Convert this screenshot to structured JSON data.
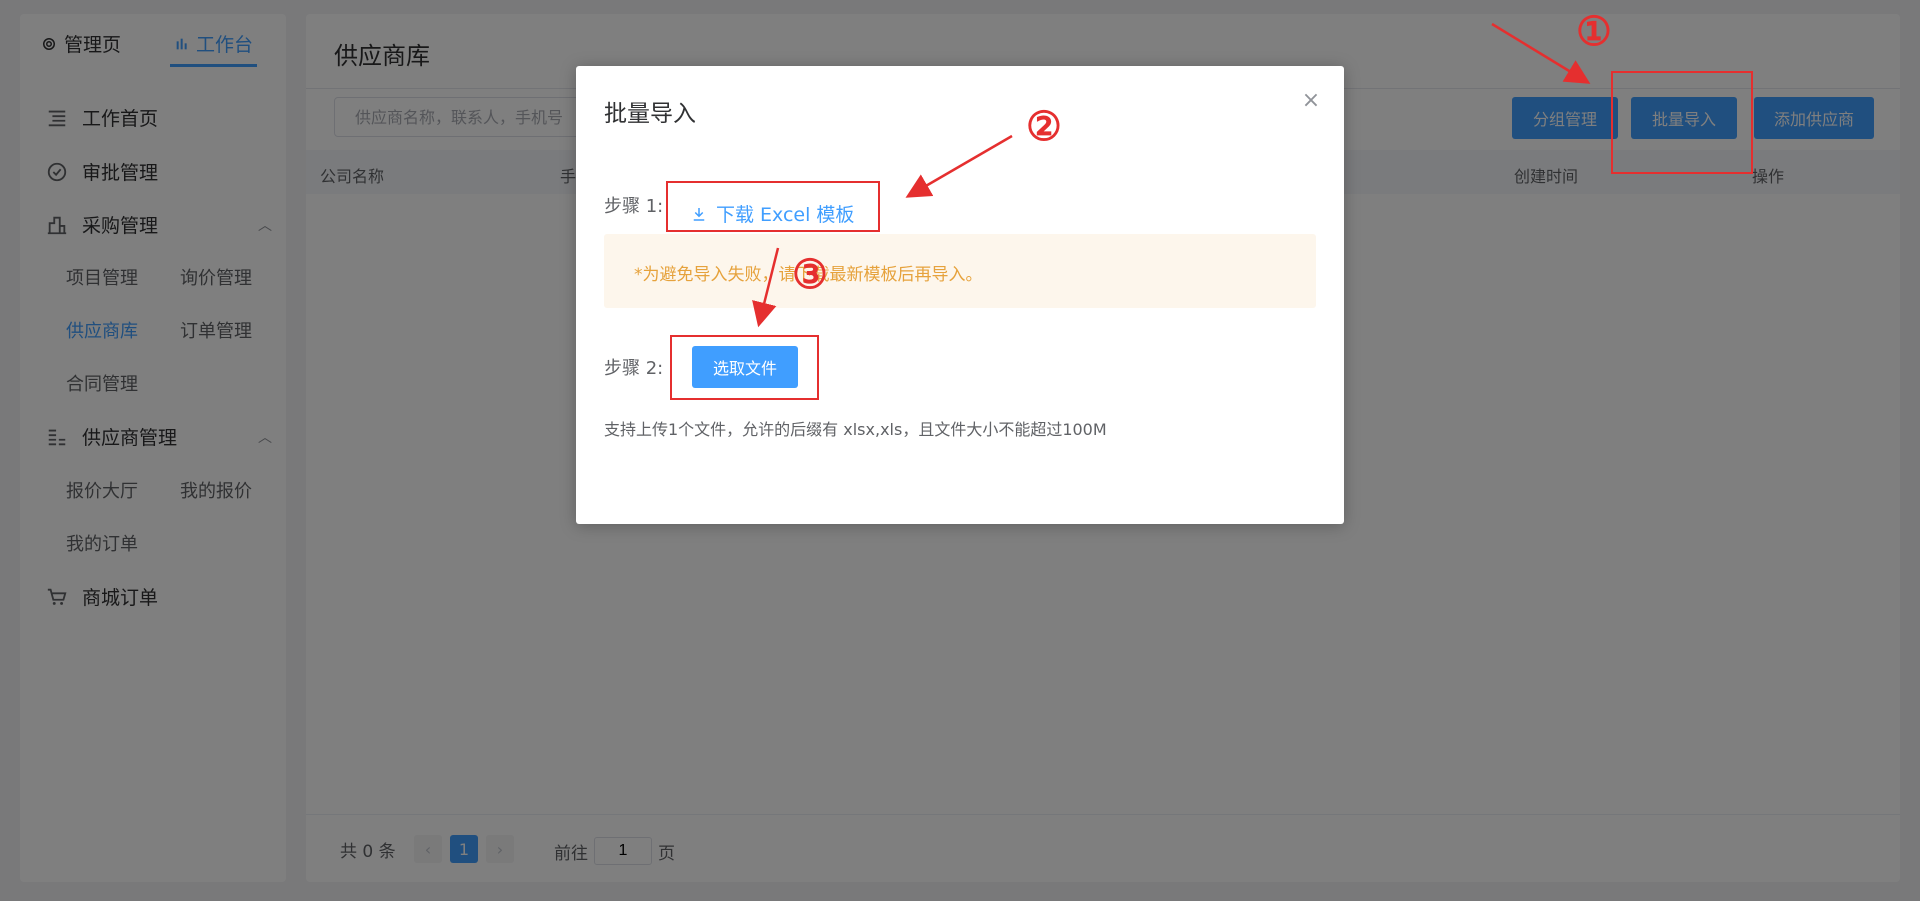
{
  "sidebar": {
    "tabs": [
      {
        "label": "管理页",
        "icon": "gear-icon"
      },
      {
        "label": "工作台",
        "icon": "bar-chart-icon"
      }
    ],
    "menu": [
      {
        "label": "工作首页",
        "icon": "list-icon"
      },
      {
        "label": "审批管理",
        "icon": "check-circle-icon"
      },
      {
        "label": "采购管理",
        "icon": "building-icon",
        "expanded": true,
        "children": [
          "项目管理",
          "询价管理",
          "供应商库",
          "订单管理",
          "合同管理"
        ]
      },
      {
        "label": "供应商管理",
        "icon": "stack-icon",
        "expanded": true,
        "children": [
          "报价大厅",
          "我的报价",
          "我的订单"
        ]
      },
      {
        "label": "商城订单",
        "icon": "cart-icon"
      }
    ],
    "active_item": "供应商库"
  },
  "main": {
    "title": "供应商库",
    "search_placeholder": "供应商名称，联系人，手机号",
    "buttons": {
      "group": "分组管理",
      "import": "批量导入",
      "add": "添加供应商"
    },
    "table_headers": [
      "公司名称",
      "手",
      "创建时间",
      "操作"
    ],
    "pagination": {
      "total_text": "共 0 条",
      "current_page": "1",
      "goto_label": "前往",
      "goto_value": "1",
      "page_suffix": "页"
    }
  },
  "dialog": {
    "title": "批量导入",
    "step1_label": "步骤 1:",
    "download_label": "下载 Excel 模板",
    "notice": "*为避免导入失败，请下载最新模板后再导入。",
    "step2_label": "步骤 2:",
    "pick_file": "选取文件",
    "hint": "支持上传1个文件，允许的后缀有 xlsx,xls，且文件大小不能超过100M"
  },
  "annotations": {
    "marks": [
      "①",
      "②",
      "③"
    ],
    "color": "#e52f2f"
  },
  "colors": {
    "primary": "#409eff",
    "warning": "#e6a23c",
    "warning_bg": "#fdf6ec"
  }
}
